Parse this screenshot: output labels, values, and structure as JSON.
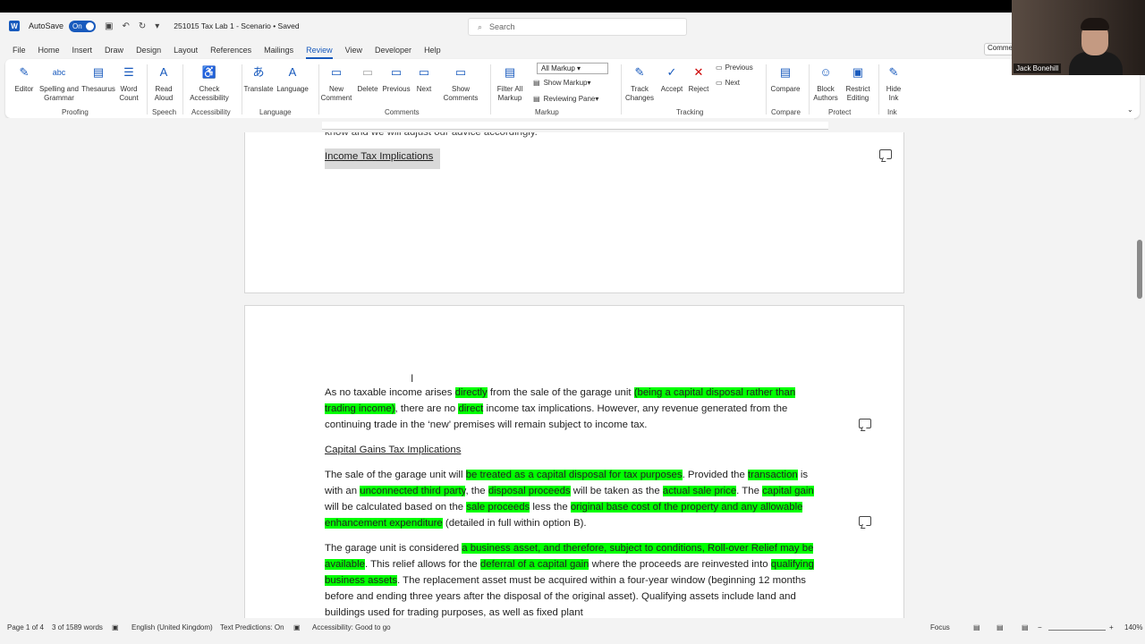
{
  "titlebar": {
    "autosave_label": "AutoSave",
    "autosave_state": "On",
    "doc_title": "251015 Tax Lab 1 - Scenario • Saved",
    "search_placeholder": "Search"
  },
  "menu": {
    "tabs": [
      "File",
      "Home",
      "Insert",
      "Draw",
      "Design",
      "Layout",
      "References",
      "Mailings",
      "Review",
      "View",
      "Developer",
      "Help"
    ],
    "active": "Review",
    "comments_button": "Comments"
  },
  "ribbon": {
    "buttons": {
      "editor": "Editor",
      "spelling1": "Spelling and",
      "spelling2": "Grammar",
      "thesaurus": "Thesaurus",
      "wordcount1": "Word",
      "wordcount2": "Count",
      "readaloud1": "Read",
      "readaloud2": "Aloud",
      "checkacc1": "Check",
      "checkacc2": "Accessibility",
      "translate": "Translate",
      "language": "Language",
      "newcomment1": "New",
      "newcomment2": "Comment",
      "delete": "Delete",
      "previous": "Previous",
      "next": "Next",
      "showcomments1": "Show",
      "showcomments2": "Comments",
      "filterall1": "Filter All",
      "filterall2": "Markup",
      "track1": "Track",
      "track2": "Changes",
      "accept": "Accept",
      "reject": "Reject",
      "prev_change": "Previous",
      "next_change": "Next",
      "compare": "Compare",
      "block1": "Block",
      "block2": "Authors",
      "restrict1": "Restrict",
      "restrict2": "Editing",
      "hideink1": "Hide",
      "hideink2": "Ink"
    },
    "markup_select": "All Markup",
    "show_markup": "Show Markup",
    "reviewing_pane": "Reviewing Pane",
    "groups": [
      "Proofing",
      "Speech",
      "Accessibility",
      "Language",
      "Comments",
      "Markup",
      "Tracking",
      "Compare",
      "Protect",
      "Ink"
    ]
  },
  "video": {
    "participant_name": "Jack Bonehill"
  },
  "page1": {
    "cut_line": "know and we will adjust our advice accordingly.",
    "heading": "Income Tax Implications"
  },
  "page2": {
    "p1": [
      {
        "t": "As no taxable income arises ",
        "h": false
      },
      {
        "t": "directly",
        "h": true
      },
      {
        "t": " from the sale of the garage unit ",
        "h": false
      },
      {
        "t": "(being a capital disposal rather than trading income)",
        "h": true
      },
      {
        "t": ", there are no ",
        "h": false
      },
      {
        "t": "direct",
        "h": true
      },
      {
        "t": " income tax implications. However, any revenue generated from the continuing trade in the ‘new’ premises will remain subject to income tax.",
        "h": false
      }
    ],
    "heading2": "Capital Gains Tax Implications",
    "p2": [
      {
        "t": "The sale of the garage unit will ",
        "h": false
      },
      {
        "t": "be treated as a capital disposal for tax purposes",
        "h": true
      },
      {
        "t": ". Provided the ",
        "h": false
      },
      {
        "t": "transaction",
        "h": true
      },
      {
        "t": " is with an ",
        "h": false
      },
      {
        "t": "unconnected third party",
        "h": true
      },
      {
        "t": ", the ",
        "h": false
      },
      {
        "t": "disposal proceeds",
        "h": true
      },
      {
        "t": " will be taken as the ",
        "h": false
      },
      {
        "t": "actual sale price",
        "h": true
      },
      {
        "t": ". The ",
        "h": false
      },
      {
        "t": "capital gain",
        "h": true
      },
      {
        "t": " will be calculated based on the ",
        "h": false
      },
      {
        "t": "sale proceeds",
        "h": true
      },
      {
        "t": " less the ",
        "h": false
      },
      {
        "t": "original base cost of the property and any allowable enhancement expenditure",
        "h": true
      },
      {
        "t": " (detailed in full within option B).",
        "h": false
      }
    ],
    "p3": [
      {
        "t": "The garage unit is considered ",
        "h": false
      },
      {
        "t": "a business asset, and therefore, subject to conditions, Roll-over Relief may be available",
        "h": true
      },
      {
        "t": ". This relief allows for the ",
        "h": false
      },
      {
        "t": "deferral of a capital gain",
        "h": true
      },
      {
        "t": " where the proceeds are reinvested into ",
        "h": false
      },
      {
        "t": "qualifying business assets",
        "h": true
      },
      {
        "t": ". The replacement asset must be acquired within a four-year window (beginning 12 months before and ending three years after the disposal of the original asset). Qualifying assets include land and buildings used for trading purposes, as well as fixed plant",
        "h": false
      }
    ]
  },
  "status": {
    "page": "Page 1 of 4",
    "words": "3 of 1589 words",
    "language": "English (United Kingdom)",
    "predictions": "Text Predictions: On",
    "accessibility": "Accessibility: Good to go",
    "focus": "Focus",
    "zoom": "140%"
  },
  "colors": {
    "highlight": "#00ff00",
    "accent": "#185abd"
  }
}
